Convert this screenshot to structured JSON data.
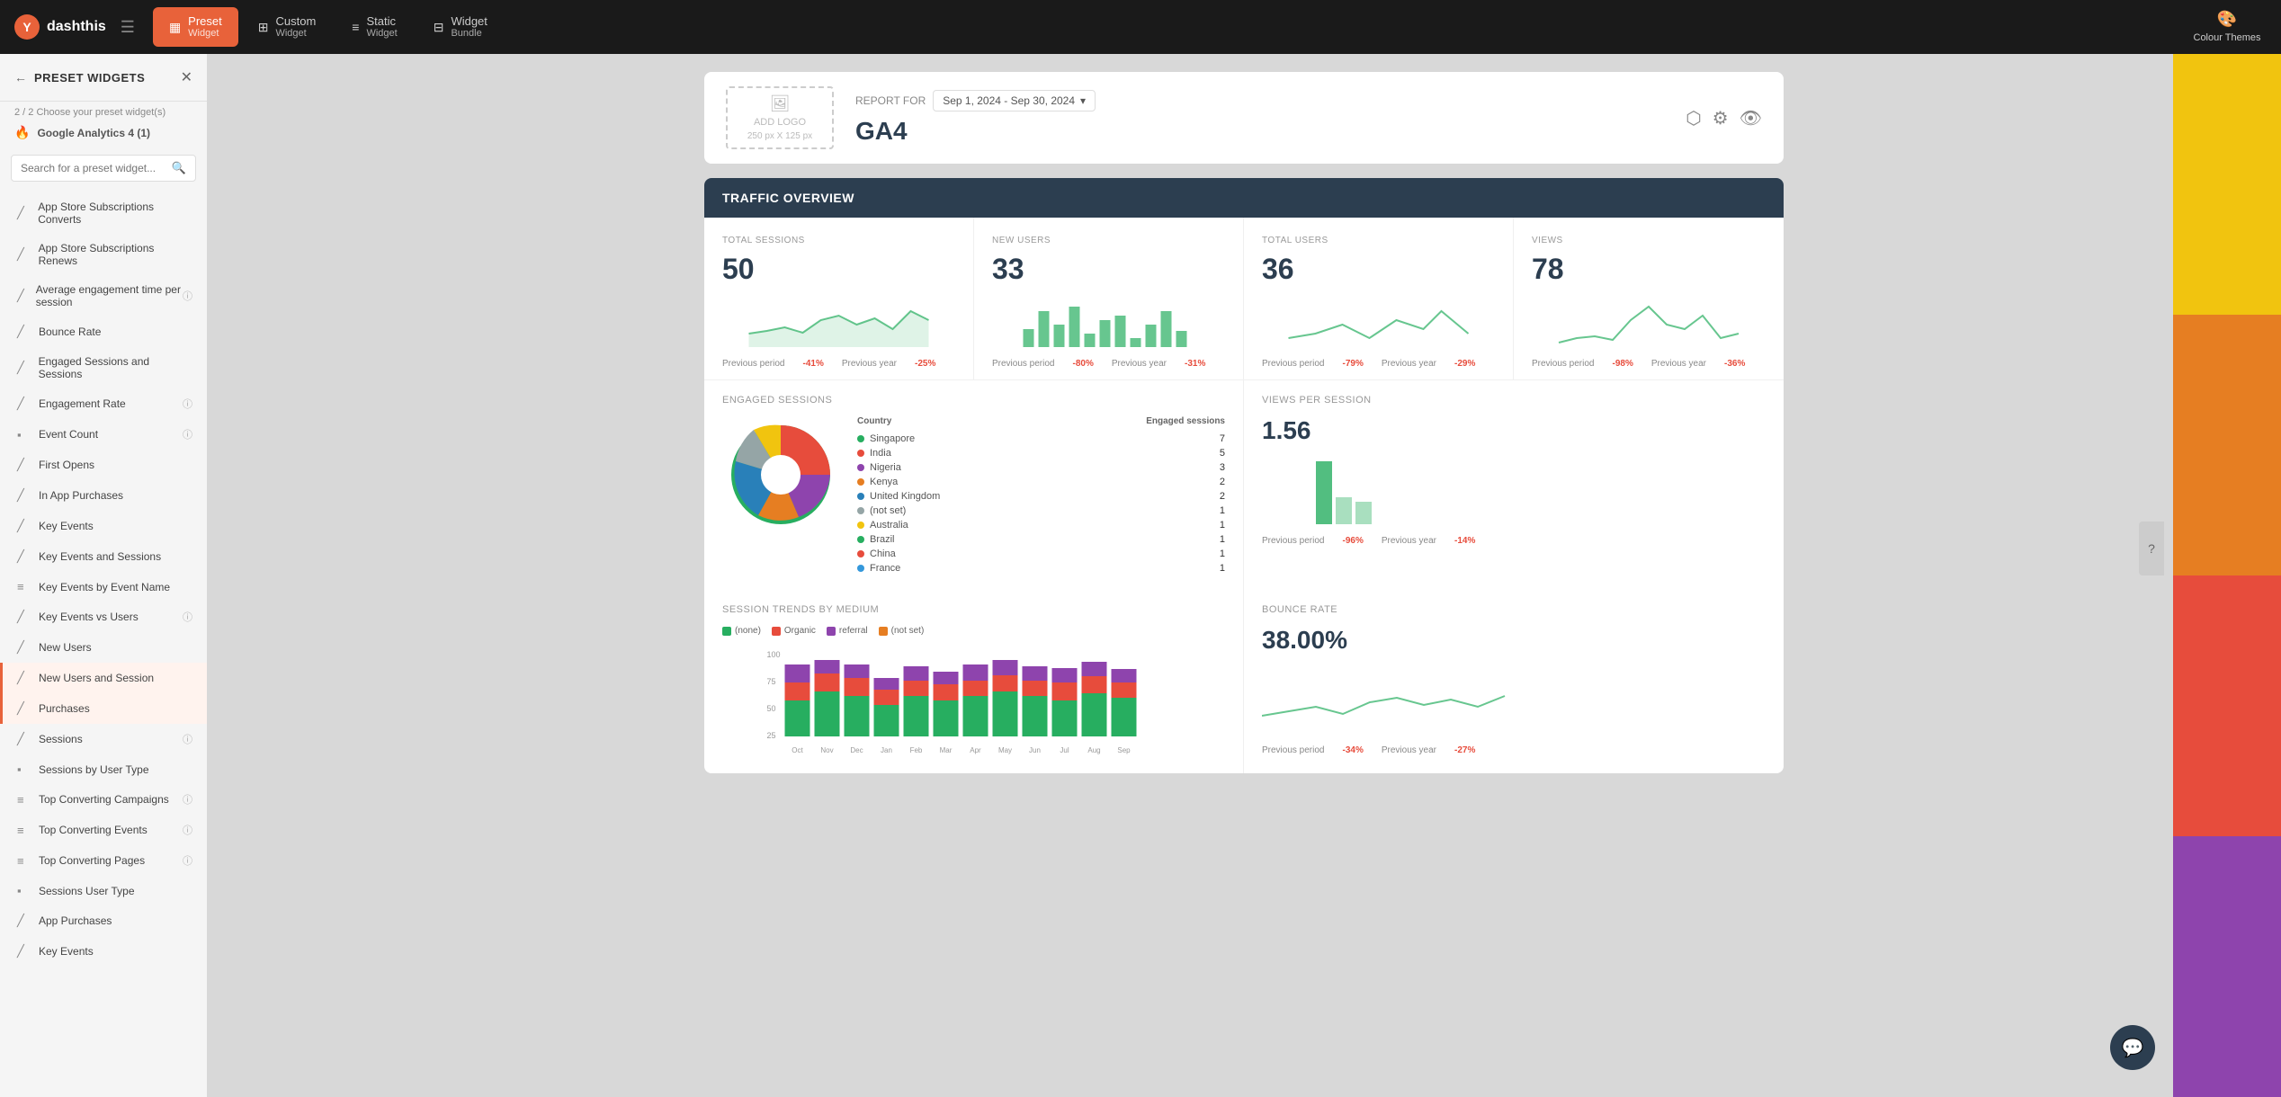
{
  "app": {
    "name": "dashthis",
    "logo_text": "dashthis"
  },
  "top_nav": {
    "menu_icon": "☰",
    "tabs": [
      {
        "id": "preset",
        "label": "Preset",
        "sublabel": "Widget",
        "icon": "▦",
        "active": true
      },
      {
        "id": "custom",
        "label": "Custom",
        "sublabel": "Widget",
        "icon": "⊞",
        "active": false
      },
      {
        "id": "static",
        "label": "Static",
        "sublabel": "Widget",
        "icon": "≡",
        "active": false
      },
      {
        "id": "bundle",
        "label": "Widget",
        "sublabel": "Bundle",
        "icon": "⊟",
        "active": false
      }
    ],
    "colour_themes_label": "Colour\nThemes"
  },
  "sidebar": {
    "title": "PRESET WIDGETS",
    "step": "2 / 2  Choose your preset widget(s)",
    "ga_label": "Google Analytics 4 (1)",
    "search_placeholder": "Search for a preset widget...",
    "items": [
      {
        "label": "App Store Subscriptions Converts",
        "icon": "📈",
        "info": false,
        "highlighted": false
      },
      {
        "label": "App Store Subscriptions Renews",
        "icon": "📈",
        "info": false,
        "highlighted": false
      },
      {
        "label": "Average engagement time per session",
        "icon": "📈",
        "info": true,
        "highlighted": false
      },
      {
        "label": "Bounce Rate",
        "icon": "📈",
        "info": false,
        "highlighted": false
      },
      {
        "label": "Engaged Sessions and Sessions",
        "icon": "📈",
        "info": false,
        "highlighted": false
      },
      {
        "label": "Engagement Rate",
        "icon": "📈",
        "info": true,
        "highlighted": false
      },
      {
        "label": "Event Count",
        "icon": "📈",
        "info": true,
        "highlighted": false
      },
      {
        "label": "First Opens",
        "icon": "📈",
        "info": false,
        "highlighted": false
      },
      {
        "label": "In App Purchases",
        "icon": "📈",
        "info": false,
        "highlighted": false
      },
      {
        "label": "Key Events",
        "icon": "📈",
        "info": false,
        "highlighted": false
      },
      {
        "label": "Key Events and Sessions",
        "icon": "📈",
        "info": false,
        "highlighted": false
      },
      {
        "label": "Key Events by Event Name",
        "icon": "📈",
        "info": false,
        "highlighted": false
      },
      {
        "label": "Key Events vs Users",
        "icon": "📈",
        "info": true,
        "highlighted": false
      },
      {
        "label": "New Users",
        "icon": "📈",
        "info": false,
        "highlighted": false
      },
      {
        "label": "New Users and Session",
        "icon": "📈",
        "info": false,
        "highlighted": true
      },
      {
        "label": "Purchases",
        "icon": "📈",
        "info": false,
        "highlighted": true
      },
      {
        "label": "Sessions",
        "icon": "📈",
        "info": true,
        "highlighted": false
      },
      {
        "label": "Sessions by User Type",
        "icon": "📈",
        "info": false,
        "highlighted": false
      },
      {
        "label": "Top Converting Campaigns",
        "icon": "📈",
        "info": true,
        "highlighted": false
      },
      {
        "label": "Top Converting Events",
        "icon": "📈",
        "info": true,
        "highlighted": false
      },
      {
        "label": "Top Converting Pages",
        "icon": "📈",
        "info": true,
        "highlighted": false
      },
      {
        "label": "Sessions User Type",
        "icon": "📈",
        "info": false,
        "highlighted": false
      },
      {
        "label": "App Purchases",
        "icon": "📈",
        "info": false,
        "highlighted": false
      },
      {
        "label": "Key Events",
        "icon": "📈",
        "info": false,
        "highlighted": false
      }
    ]
  },
  "report": {
    "report_for_label": "REPORT FOR",
    "date_range": "Sep 1, 2024 - Sep 30, 2024",
    "title": "GA4",
    "logo_label": "ADD LOGO",
    "logo_size": "250 px X 125 px"
  },
  "traffic_overview": {
    "title": "TRAFFIC OVERVIEW",
    "metrics": [
      {
        "label": "TOTAL SESSIONS",
        "value": "50",
        "prev_label": "Previous period",
        "prev_change": "-41%",
        "year_label": "Previous year",
        "year_change": "-25%"
      },
      {
        "label": "NEW USERS",
        "value": "33",
        "prev_label": "Previous period",
        "prev_change": "-80%",
        "year_label": "Previous year",
        "year_change": "-31%"
      },
      {
        "label": "TOTAL USERS",
        "value": "36",
        "prev_label": "Previous period",
        "prev_change": "-79%",
        "year_label": "Previous year",
        "year_change": "-29%"
      },
      {
        "label": "VIEWS",
        "value": "78",
        "prev_label": "Previous period",
        "prev_change": "-98%",
        "year_label": "Previous year",
        "year_change": "-36%"
      }
    ]
  },
  "engaged_sessions": {
    "title": "ENGAGED SESSIONS",
    "country_label": "Country",
    "sessions_label": "Engaged sessions",
    "countries": [
      {
        "name": "Singapore",
        "count": "7",
        "color": "#27ae60"
      },
      {
        "name": "India",
        "count": "5",
        "color": "#e74c3c"
      },
      {
        "name": "Nigeria",
        "count": "3",
        "color": "#8e44ad"
      },
      {
        "name": "Kenya",
        "count": "2",
        "color": "#e67e22"
      },
      {
        "name": "United Kingdom",
        "count": "2",
        "color": "#2980b9"
      },
      {
        "name": "(not set)",
        "count": "1",
        "color": "#95a5a6"
      },
      {
        "name": "Australia",
        "count": "1",
        "color": "#f1c40f"
      },
      {
        "name": "Brazil",
        "count": "1",
        "color": "#27ae60"
      },
      {
        "name": "China",
        "count": "1",
        "color": "#e74c3c"
      },
      {
        "name": "France",
        "count": "1",
        "color": "#3498db"
      }
    ]
  },
  "views_per_session": {
    "title": "VIEWS PER SESSION",
    "value": "1.56",
    "prev_label": "Previous period",
    "prev_change": "-96%",
    "year_label": "Previous year",
    "year_change": "-14%"
  },
  "bounce_rate": {
    "title": "BOUNCE RATE",
    "value": "38.00%",
    "prev_label": "Previous period",
    "prev_change": "-34%",
    "year_label": "Previous year",
    "year_change": "-27%"
  },
  "session_trends": {
    "title": "SESSION TRENDS BY MEDIUM",
    "legend": [
      {
        "label": "(none)",
        "color": "#27ae60"
      },
      {
        "label": "Organic",
        "color": "#e74c3c"
      },
      {
        "label": "referral",
        "color": "#8e44ad"
      },
      {
        "label": "(not set)",
        "color": "#e67e22"
      }
    ],
    "y_labels": [
      "100",
      "75",
      "50",
      "25"
    ],
    "x_labels": [
      "Oct",
      "Nov",
      "Dec",
      "Jan",
      "Feb",
      "Mar",
      "Apr",
      "May",
      "Jun",
      "Jul",
      "Aug",
      "Sep"
    ]
  },
  "colour_themes": {
    "label": "Colour\nThemes",
    "stripes": [
      "#f1c40f",
      "#e67e22",
      "#e74c3c",
      "#8e44ad"
    ]
  }
}
